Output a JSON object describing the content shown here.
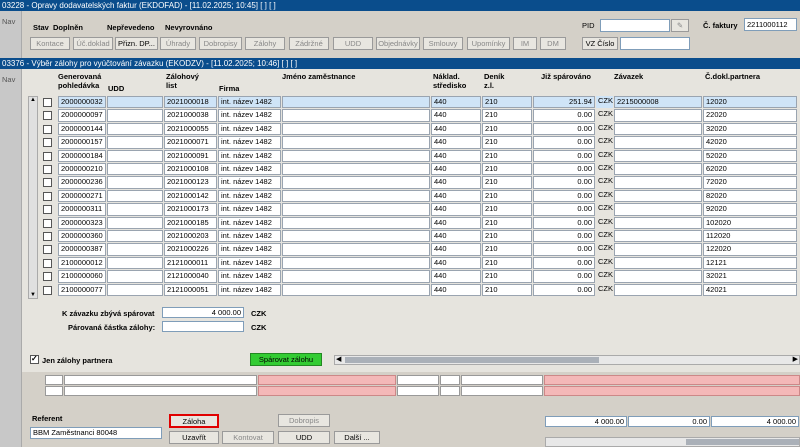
{
  "outer_window": {
    "title": "03228 - Opravy dodavatelských faktur (EKDOFAD) - [11.02.2025; 10:45]  [ ]  [ ]",
    "side_tab": "Nav",
    "status_labels": {
      "stav": "Stav",
      "doplnen": "Doplněn",
      "neprevedeno": "Nepřevedeno",
      "nevyrovnano": "Nevyrovnáno"
    },
    "pid_label": "PID",
    "pid_value": "",
    "faktura_label": "Č. faktury",
    "faktura_value": "2211000112",
    "vz_label": "VZ Číslo",
    "vz_value": "",
    "toolbar": [
      "Kontace",
      "Úč.doklad",
      "Přizn. DP...",
      "Úhrady",
      "Dobropisy",
      "Zálohy",
      "Zádržné",
      "UDD",
      "Objednávky",
      "Smlouvy",
      "Upomínky",
      "IM",
      "DM"
    ]
  },
  "inner_window": {
    "title": "03376 - Výběr zálohy pro vyúčtování závazku (EKODZV) - [11.02.2025; 10:46]  [ ]  [ ]",
    "side_tab": "Nav",
    "columns": {
      "generovana": "Generovaná pohledávka",
      "udd": "UDD",
      "zalohovy": "Zálohový list",
      "firma": "Firma",
      "jmeno": "Jméno zaměstnance",
      "naklad": "Náklad. středisko",
      "denik": "Deník z.l.",
      "sparovano": "Již spárováno",
      "zavazek": "Závazek",
      "cdokl": "Č.dokl.partnera"
    },
    "rows": [
      {
        "generovana": "2000000032",
        "zalohovy": "2021000018",
        "firma": "int. název 1482",
        "naklad": "440",
        "denik": "210",
        "sparovano": "251.94",
        "mena": "CZK",
        "zavazek": "2215000008",
        "cdokl": "12020"
      },
      {
        "generovana": "2000000097",
        "zalohovy": "2021000038",
        "firma": "int. název 1482",
        "naklad": "440",
        "denik": "210",
        "sparovano": "0.00",
        "mena": "CZK",
        "zavazek": "",
        "cdokl": "22020"
      },
      {
        "generovana": "2000000144",
        "zalohovy": "2021000055",
        "firma": "int. název 1482",
        "naklad": "440",
        "denik": "210",
        "sparovano": "0.00",
        "mena": "CZK",
        "zavazek": "",
        "cdokl": "32020"
      },
      {
        "generovana": "2000000157",
        "zalohovy": "2021000071",
        "firma": "int. název 1482",
        "naklad": "440",
        "denik": "210",
        "sparovano": "0.00",
        "mena": "CZK",
        "zavazek": "",
        "cdokl": "42020"
      },
      {
        "generovana": "2000000184",
        "zalohovy": "2021000091",
        "firma": "int. název 1482",
        "naklad": "440",
        "denik": "210",
        "sparovano": "0.00",
        "mena": "CZK",
        "zavazek": "",
        "cdokl": "52020"
      },
      {
        "generovana": "2000000210",
        "zalohovy": "2021000108",
        "firma": "int. název 1482",
        "naklad": "440",
        "denik": "210",
        "sparovano": "0.00",
        "mena": "CZK",
        "zavazek": "",
        "cdokl": "62020"
      },
      {
        "generovana": "2000000236",
        "zalohovy": "2021000123",
        "firma": "int. název 1482",
        "naklad": "440",
        "denik": "210",
        "sparovano": "0.00",
        "mena": "CZK",
        "zavazek": "",
        "cdokl": "72020"
      },
      {
        "generovana": "2000000271",
        "zalohovy": "2021000142",
        "firma": "int. název 1482",
        "naklad": "440",
        "denik": "210",
        "sparovano": "0.00",
        "mena": "CZK",
        "zavazek": "",
        "cdokl": "82020"
      },
      {
        "generovana": "2000000311",
        "zalohovy": "2021000173",
        "firma": "int. název 1482",
        "naklad": "440",
        "denik": "210",
        "sparovano": "0.00",
        "mena": "CZK",
        "zavazek": "",
        "cdokl": "92020"
      },
      {
        "generovana": "2000000323",
        "zalohovy": "2021000185",
        "firma": "int. název 1482",
        "naklad": "440",
        "denik": "210",
        "sparovano": "0.00",
        "mena": "CZK",
        "zavazek": "",
        "cdokl": "102020"
      },
      {
        "generovana": "2000000360",
        "zalohovy": "2021000203",
        "firma": "int. název 1482",
        "naklad": "440",
        "denik": "210",
        "sparovano": "0.00",
        "mena": "CZK",
        "zavazek": "",
        "cdokl": "112020"
      },
      {
        "generovana": "2000000387",
        "zalohovy": "2021000226",
        "firma": "int. název 1482",
        "naklad": "440",
        "denik": "210",
        "sparovano": "0.00",
        "mena": "CZK",
        "zavazek": "",
        "cdokl": "122020"
      },
      {
        "generovana": "2100000012",
        "zalohovy": "2121000011",
        "firma": "int. název 1482",
        "naklad": "440",
        "denik": "210",
        "sparovano": "0.00",
        "mena": "CZK",
        "zavazek": "",
        "cdokl": "12121"
      },
      {
        "generovana": "2100000060",
        "zalohovy": "2121000040",
        "firma": "int. název 1482",
        "naklad": "440",
        "denik": "210",
        "sparovano": "0.00",
        "mena": "CZK",
        "zavazek": "",
        "cdokl": "32021"
      },
      {
        "generovana": "2100000077",
        "zalohovy": "2121000051",
        "firma": "int. název 1482",
        "naklad": "440",
        "denik": "210",
        "sparovano": "0.00",
        "mena": "CZK",
        "zavazek": "",
        "cdokl": "42021"
      }
    ],
    "k_zavazku_label": "K závazku zbývá spárovat",
    "k_zavazku_value": "4 000.00",
    "k_zavazku_mena": "CZK",
    "parovana_label": "Párovaná částka zálohy:",
    "parovana_value": "",
    "parovana_mena": "CZK",
    "jen_zalohy_label": "Jen zálohy partnera",
    "sparovat_label": "Spárovat zálohu"
  },
  "footer": {
    "referent_label": "Referent",
    "referent_value": "BBM Zaměstnanci 80048",
    "buttons": {
      "zaloha": "Záloha",
      "dobropis": "Dobropis",
      "uzavrit": "Uzavřít",
      "kontovat": "Kontovat",
      "udd": "UDD",
      "dalsi": "Další ..."
    },
    "totals": [
      "4 000.00",
      "0.00",
      "4 000.00"
    ]
  },
  "colors": {
    "title_bar": "#0a4d8c",
    "selected_row": "#cfe4f7",
    "highlight_border": "#e00000",
    "sparovat_green": "#33cc33"
  }
}
